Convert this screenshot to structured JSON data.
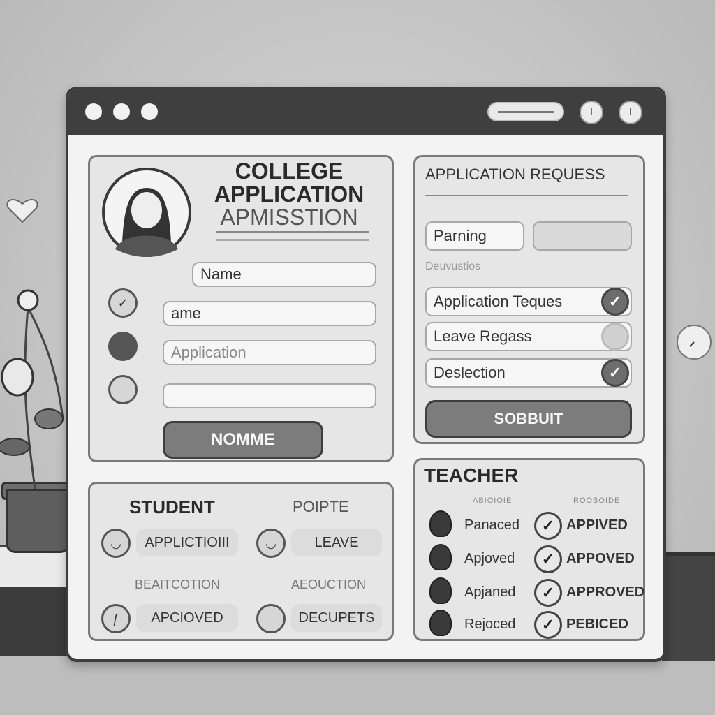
{
  "window": {
    "title_pill": "▬▬▬▬▬▬▬▬",
    "buttons": [
      "I",
      "I"
    ]
  },
  "application_form": {
    "title_line1": "COLLEGE",
    "title_line2": "APPLICATION",
    "title_line3": "APMISSTION",
    "fields": [
      "Name",
      "ame",
      "Application",
      ""
    ],
    "submit_label": "NOMME"
  },
  "request_panel": {
    "title": "APPLICATION REQUESS",
    "chip_left": "Parning",
    "chip_right": "",
    "section_label": "Deuvustios",
    "options": [
      {
        "label": "Application Teques",
        "checked": true
      },
      {
        "label": "Leave Regass",
        "checked": false
      },
      {
        "label": "Deslection",
        "checked": true
      }
    ],
    "submit_label": "SOBBUIT"
  },
  "student_panel": {
    "title": "STUDENT",
    "title_right": "POIPTE",
    "items": [
      {
        "label": "APPLICTIOIII"
      },
      {
        "label": "LEAVE"
      },
      {
        "label": "BEAITCOTION"
      },
      {
        "label": "AEOUCTION"
      },
      {
        "label": "APCIOVED"
      },
      {
        "label": "DECUPETS"
      }
    ]
  },
  "teacher_panel": {
    "title": "TEACHER",
    "col_left": "ABIOIOIE",
    "col_right": "ROOBOIDE",
    "rows": [
      {
        "status": "Panaced",
        "result": "APPIVED"
      },
      {
        "status": "Apjoved",
        "result": "APPOVED"
      },
      {
        "status": "Apjaned",
        "result": "APPROVED"
      },
      {
        "status": "Rejoced",
        "result": "PEBICED"
      }
    ]
  }
}
